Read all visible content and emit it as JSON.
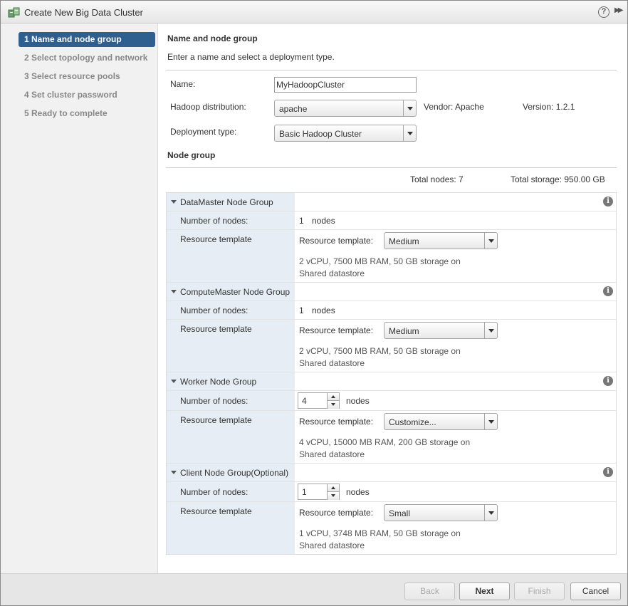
{
  "window": {
    "title": "Create New Big Data Cluster",
    "help_icon": "?"
  },
  "steps": [
    {
      "label": "1  Name and node group",
      "active": true
    },
    {
      "label": "2  Select topology and network",
      "active": false
    },
    {
      "label": "3  Select resource pools",
      "active": false
    },
    {
      "label": "4  Set cluster password",
      "active": false
    },
    {
      "label": "5  Ready to complete",
      "active": false
    }
  ],
  "section": {
    "title": "Name and node group",
    "description": "Enter a name and select a deployment type."
  },
  "form": {
    "name_label": "Name:",
    "name_value": "MyHadoopCluster",
    "distribution_label": "Hadoop distribution:",
    "distribution_value": "apache",
    "vendor": "Vendor: Apache",
    "version": "Version: 1.2.1",
    "deployment_label": "Deployment type:",
    "deployment_value": "Basic Hadoop Cluster"
  },
  "node_group": {
    "title": "Node group",
    "total_nodes": "Total nodes: 7",
    "total_storage": "Total storage: 950.00 GB",
    "groups": [
      {
        "name": "DataMaster Node Group",
        "nodes_label": "Number of nodes:",
        "nodes": "1",
        "nodes_unit": "nodes",
        "template_label": "Resource template",
        "template_field_label": "Resource template:",
        "template": "Medium",
        "desc1": "2 vCPU, 7500 MB RAM, 50 GB storage on",
        "desc2": "Shared datastore"
      },
      {
        "name": "ComputeMaster Node Group",
        "nodes_label": "Number of nodes:",
        "nodes": "1",
        "nodes_unit": "nodes",
        "template_label": "Resource template",
        "template_field_label": "Resource template:",
        "template": "Medium",
        "desc1": "2 vCPU, 7500 MB RAM, 50 GB storage on",
        "desc2": "Shared datastore"
      },
      {
        "name": "Worker Node Group",
        "nodes_label": "Number of nodes:",
        "nodes": "4",
        "nodes_unit": "nodes",
        "template_label": "Resource template",
        "template_field_label": "Resource template:",
        "template": "Customize...",
        "desc1": "4 vCPU, 15000 MB RAM, 200 GB storage on",
        "desc2": "Shared datastore"
      },
      {
        "name": "Client Node Group(Optional)",
        "nodes_label": "Number of nodes:",
        "nodes": "1",
        "nodes_unit": "nodes",
        "template_label": "Resource template",
        "template_field_label": "Resource template:",
        "template": "Small",
        "desc1": "1 vCPU, 3748 MB RAM, 50 GB storage on",
        "desc2": "Shared datastore"
      }
    ]
  },
  "footer": {
    "back": "Back",
    "next": "Next",
    "finish": "Finish",
    "cancel": "Cancel"
  },
  "colors": {
    "accent": "#2f5f8f",
    "sidebar_bg": "#f1f1f1",
    "group_label_bg": "#e6edf4"
  }
}
